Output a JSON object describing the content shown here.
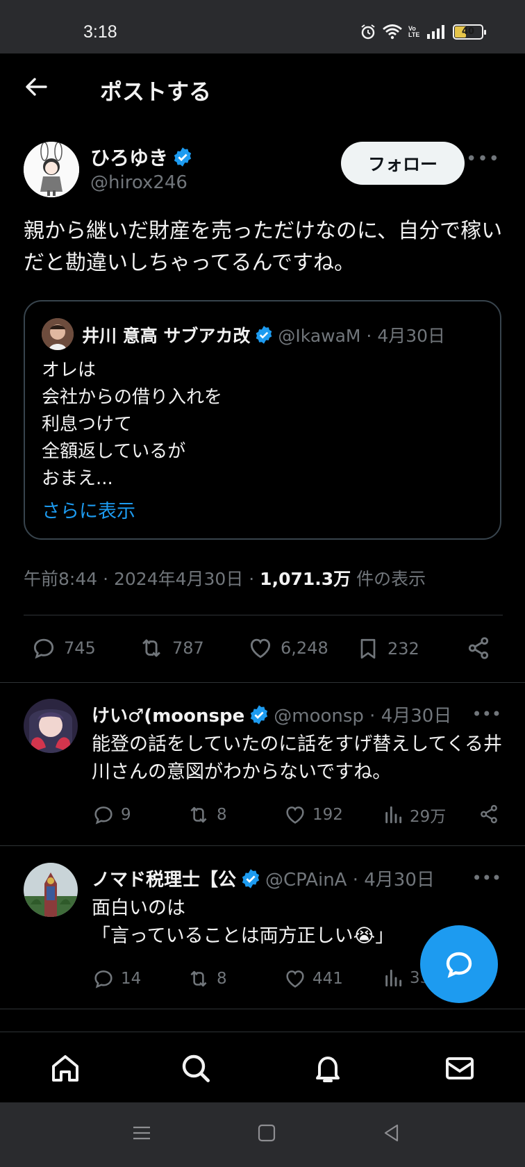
{
  "status_bar": {
    "time": "3:18",
    "battery": "40",
    "network": "Vo LTE"
  },
  "header": {
    "title": "ポストする"
  },
  "post": {
    "name": "ひろゆき",
    "handle": "@hirox246",
    "follow_label": "フォロー",
    "text": "親から継いだ財産を売っただけなのに、自分で稼いだと勘違いしちゃってるんですね。",
    "quote": {
      "name": "井川 意高 サブアカ改",
      "meta": "@IkawaM · 4月30日",
      "lines": [
        "オレは",
        "会社からの借り入れを",
        "利息つけて",
        "全額返しているが",
        "おまえ..."
      ],
      "show_more": "さらに表示"
    },
    "timestamp": "午前8:44 · 2024年4月30日 · ",
    "views_count": "1,071.3万",
    "views_label": " 件の表示",
    "replies": "745",
    "reposts": "787",
    "likes": "6,248",
    "bookmarks": "232"
  },
  "replies": [
    {
      "name": "けい♂(moonspe",
      "meta": "@moonsp · 4月30日",
      "text": "能登の話をしていたのに話をすげ替えしてくる井川さんの意図がわからないですね。",
      "replies": "9",
      "reposts": "8",
      "likes": "192",
      "views": "29万"
    },
    {
      "name": "ノマド税理士【公",
      "meta": "@CPAinA · 4月30日",
      "text_line1": "面白いのは",
      "text_line2": "「言っていることは両方正しい😭」",
      "replies": "14",
      "reposts": "8",
      "likes": "441",
      "views": "33"
    }
  ],
  "colors": {
    "accent": "#1d9bf0",
    "background": "#000000",
    "muted": "#71767b"
  }
}
